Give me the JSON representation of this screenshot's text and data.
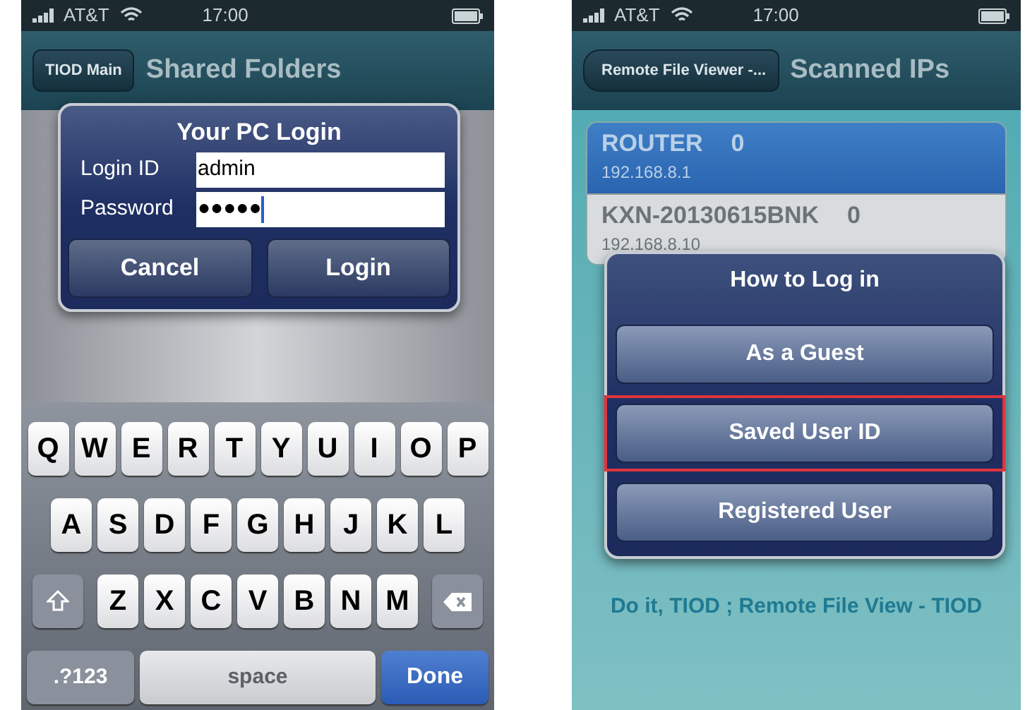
{
  "left_screen": {
    "status_bar": {
      "carrier": "AT&T",
      "time": "17:00"
    },
    "nav_bar": {
      "back_button": "TIOD Main",
      "title": "Shared Folders"
    },
    "dialog": {
      "title": "Your PC Login",
      "fields": [
        {
          "label": "Login ID",
          "value": "admin",
          "focused": false
        },
        {
          "label": "Password",
          "value": "●●●●●",
          "focused": true
        }
      ],
      "buttons": [
        "Cancel",
        "Login"
      ]
    },
    "keyboard": {
      "rows": [
        {
          "keys": [
            {
              "kind": "letter",
              "label": "Q"
            },
            {
              "kind": "letter",
              "label": "W"
            },
            {
              "kind": "letter",
              "label": "E"
            },
            {
              "kind": "letter",
              "label": "R"
            },
            {
              "kind": "letter",
              "label": "T"
            },
            {
              "kind": "letter",
              "label": "Y"
            },
            {
              "kind": "letter",
              "label": "U"
            },
            {
              "kind": "letter",
              "label": "I"
            },
            {
              "kind": "letter",
              "label": "O"
            },
            {
              "kind": "letter",
              "label": "P"
            }
          ]
        },
        {
          "keys": [
            {
              "kind": "letter",
              "label": "A"
            },
            {
              "kind": "letter",
              "label": "S"
            },
            {
              "kind": "letter",
              "label": "D"
            },
            {
              "kind": "letter",
              "label": "F"
            },
            {
              "kind": "letter",
              "label": "G"
            },
            {
              "kind": "letter",
              "label": "H"
            },
            {
              "kind": "letter",
              "label": "J"
            },
            {
              "kind": "letter",
              "label": "K"
            },
            {
              "kind": "letter",
              "label": "L"
            }
          ]
        },
        {
          "keys": [
            {
              "kind": "shift"
            },
            {
              "kind": "letter",
              "label": "Z"
            },
            {
              "kind": "letter",
              "label": "X"
            },
            {
              "kind": "letter",
              "label": "C"
            },
            {
              "kind": "letter",
              "label": "V"
            },
            {
              "kind": "letter",
              "label": "B"
            },
            {
              "kind": "letter",
              "label": "N"
            },
            {
              "kind": "letter",
              "label": "M"
            },
            {
              "kind": "delete"
            }
          ]
        },
        {
          "keys": [
            {
              "kind": "mode",
              "label": ".?123"
            },
            {
              "kind": "space",
              "label": "space"
            },
            {
              "kind": "done",
              "label": "Done"
            }
          ]
        }
      ]
    }
  },
  "right_screen": {
    "status_bar": {
      "carrier": "AT&T",
      "time": "17:00"
    },
    "nav_bar": {
      "back_button": "Remote File Viewer -...",
      "title": "Scanned IPs"
    },
    "hosts": [
      {
        "name": "ROUTER",
        "count": "0",
        "ip": "192.168.8.1",
        "selected": true
      },
      {
        "name": "KXN-20130615BNK",
        "count": "0",
        "ip": "192.168.8.10",
        "selected": false
      }
    ],
    "dialog": {
      "title": "How to Log in",
      "buttons": [
        {
          "label": "As a Guest",
          "highlighted": false
        },
        {
          "label": "Saved User ID",
          "highlighted": true
        },
        {
          "label": "Registered User",
          "highlighted": false
        }
      ]
    },
    "background_text": "Do it, TIOD ; Remote File View - TIOD"
  }
}
